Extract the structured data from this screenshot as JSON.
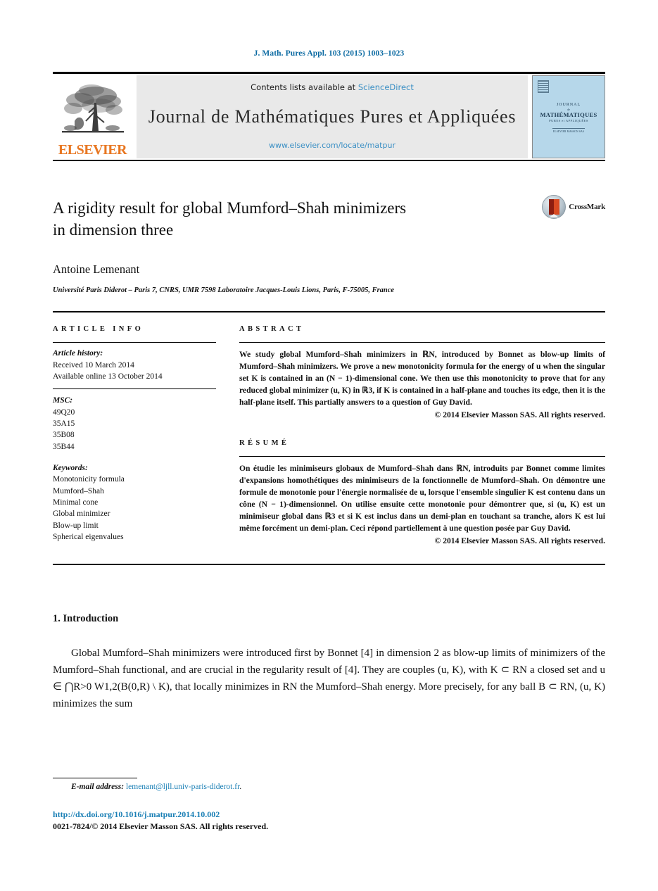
{
  "running_head": "J. Math. Pures Appl. 103 (2015) 1003–1023",
  "masthead": {
    "publisher_name": "ELSEVIER",
    "contents_prefix": "Contents lists available at ",
    "contents_link": "ScienceDirect",
    "journal_title": "Journal de Mathématiques Pures et Appliquées",
    "journal_url": "www.elsevier.com/locate/matpur",
    "cover": {
      "line1": "JOURNAL",
      "line2": "de",
      "line3": "MATHÉMATIQUES",
      "line4": "PURES et APPLIQUÉES",
      "line5": "ELSEVIER MASSON SAS"
    }
  },
  "article": {
    "title_line1": "A rigidity result for global Mumford–Shah minimizers",
    "title_line2": "in dimension three",
    "crossmark_label": "CrossMark",
    "authors": "Antoine Lemenant",
    "affiliation": "Université Paris Diderot – Paris 7, CNRS, UMR 7598 Laboratoire Jacques-Louis Lions, Paris, F-75005, France"
  },
  "info": {
    "heading": "ARTICLE INFO",
    "history_label": "Article history:",
    "history_lines": [
      "Received 10 March 2014",
      "Available online 13 October 2014"
    ],
    "msc_label": "MSC:",
    "msc_codes": [
      "49Q20",
      "35A15",
      "35B08",
      "35B44"
    ],
    "keywords_label": "Keywords:",
    "keywords": [
      "Monotonicity formula",
      "Mumford–Shah",
      "Minimal cone",
      "Global minimizer",
      "Blow-up limit",
      "Spherical eigenvalues"
    ]
  },
  "abstract": {
    "heading": "ABSTRACT",
    "text": "We study global Mumford–Shah minimizers in ℝN, introduced by Bonnet as blow-up limits of Mumford–Shah minimizers. We prove a new monotonicity formula for the energy of u when the singular set K is contained in an (N − 1)-dimensional cone. We then use this monotonicity to prove that for any reduced global minimizer (u, K) in ℝ3, if K is contained in a half-plane and touches its edge, then it is the half-plane itself. This partially answers to a question of Guy David.",
    "copyright": "© 2014 Elsevier Masson SAS. All rights reserved."
  },
  "resume": {
    "heading": "RÉSUMÉ",
    "text": "On étudie les minimiseurs globaux de Mumford–Shah dans ℝN, introduits par Bonnet comme limites d'expansions homothétiques des minimiseurs de la fonctionnelle de Mumford–Shah. On démontre une formule de monotonie pour l'énergie normalisée de u, lorsque l'ensemble singulier K est contenu dans un cône (N − 1)-dimensionnel. On utilise ensuite cette monotonie pour démontrer que, si (u, K) est un minimiseur global dans ℝ3 et si K est inclus dans un demi-plan en touchant sa tranche, alors K est lui même forcément un demi-plan. Ceci répond partiellement à une question posée par Guy David.",
    "copyright": "© 2014 Elsevier Masson SAS. All rights reserved."
  },
  "body": {
    "section_title": "1. Introduction",
    "paragraph": "Global Mumford–Shah minimizers were introduced first by Bonnet [4] in dimension 2 as blow-up limits of minimizers of the Mumford–Shah functional, and are crucial in the regularity result of [4]. They are couples (u, K), with K ⊂ RN a closed set and u ∈ ⋂R>0 W1,2(B(0,R) \\ K), that locally minimizes in RN the Mumford–Shah energy. More precisely, for any ball B ⊂ RN, (u, K) minimizes the sum",
    "reference_marks": [
      "[4]",
      "[4]"
    ]
  },
  "footer": {
    "email_label": "E-mail address:",
    "email": "lemenant@ljll.univ-paris-diderot.fr",
    "email_suffix": ".",
    "doi": "http://dx.doi.org/10.1016/j.matpur.2014.10.002",
    "issn_line": "0021-7824/© 2014 Elsevier Masson SAS. All rights reserved."
  },
  "colors": {
    "link": "#1a7fb5",
    "running_head": "#0b6aa2",
    "elsevier_orange": "#e87722",
    "band_background": "#e9e9e9",
    "cover_blue": "#b6d7ea"
  }
}
